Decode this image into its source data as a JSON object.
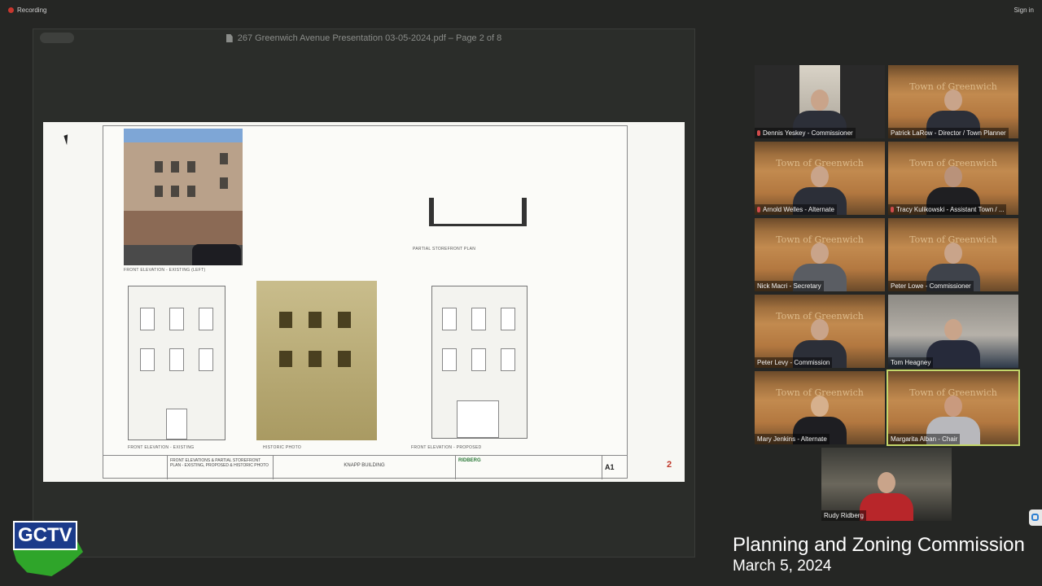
{
  "topbar": {
    "recording_label": "Recording",
    "signin_label": "Sign in"
  },
  "document": {
    "title": "267 Greenwich Avenue Presentation 03-05-2024.pdf – Page 2 of 8",
    "page_marker": "2",
    "sheet": {
      "caption_front_existing_photo": "FRONT ELEVATION - EXISTING (LEFT)",
      "caption_partial_plan": "PARTIAL STOREFRONT PLAN",
      "caption_elev_existing": "FRONT ELEVATION - EXISTING",
      "caption_historic": "HISTORIC PHOTO",
      "caption_elev_proposed": "FRONT ELEVATION - PROPOSED",
      "drawing_title": "FRONT ELEVATIONS & PARTIAL STOREFRONT PLAN - EXISTING, PROPOSED & HISTORIC PHOTO",
      "project": "KNAPP BUILDING",
      "firm": "RIDBERG",
      "sheet_number": "A1"
    }
  },
  "participants": [
    {
      "name": "Dennis Yeskey - Commissioner",
      "muted": true
    },
    {
      "name": "Patrick LaRow - Director / Town Planner",
      "muted": false
    },
    {
      "name": "Arnold Welles - Alternate",
      "muted": true
    },
    {
      "name": "Tracy Kulikowski - Assistant Town / ...",
      "muted": true
    },
    {
      "name": "Nick Macri - Secretary",
      "muted": false
    },
    {
      "name": "Peter Lowe - Commissioner",
      "muted": false
    },
    {
      "name": "Peter Levy - Commission",
      "muted": false
    },
    {
      "name": "Tom Heagney",
      "muted": false
    },
    {
      "name": "Mary Jenkins - Alternate",
      "muted": false
    },
    {
      "name": "Margarita Alban - Chair",
      "muted": false
    },
    {
      "name": "Rudy Ridberg",
      "muted": false
    }
  ],
  "wall_text": "Town of Greenwich",
  "wall_text_short": "Town",
  "broadcast": {
    "logo_text": "GCTV",
    "title": "Planning and Zoning Commission",
    "date": "March 5, 2024"
  },
  "colors": {
    "active_speaker_border": "#c3d66a",
    "page_marker": "#c0392b",
    "logo_blue": "#1b3a8a",
    "logo_green": "#2fa52a"
  },
  "icons": {
    "raised_hand": "✋"
  }
}
